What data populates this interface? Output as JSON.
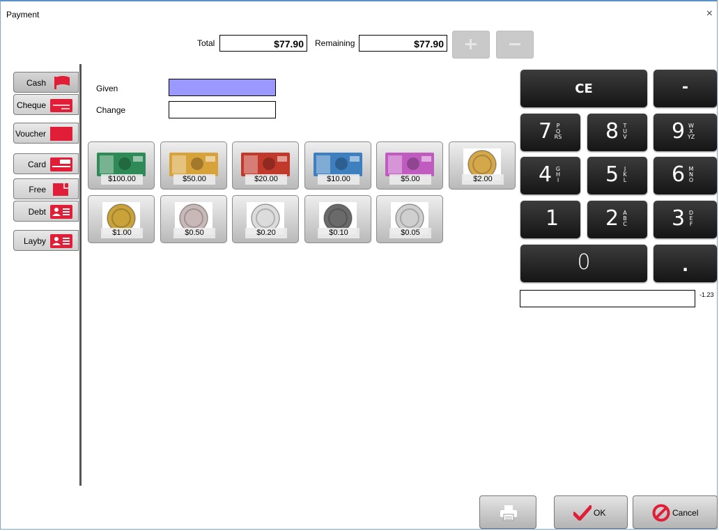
{
  "window": {
    "title": "Payment",
    "close_glyph": "×"
  },
  "header": {
    "total_label": "Total",
    "total_value": "$77.90",
    "remaining_label": "Remaining",
    "remaining_value": "$77.90",
    "plus_icon": "plus-icon",
    "minus_icon": "minus-icon"
  },
  "tabs": [
    {
      "label": "Cash",
      "icon": "flag-icon",
      "active": true
    },
    {
      "label": "Cheque",
      "icon": "cheque-icon"
    },
    {
      "label": "Voucher",
      "icon": "voucher-icon"
    },
    {
      "label": "Card",
      "icon": "card-icon"
    },
    {
      "label": "Free",
      "icon": "free-icon"
    },
    {
      "label": "Debt",
      "icon": "contact-card-icon"
    },
    {
      "label": "Layby",
      "icon": "contact-card-icon"
    }
  ],
  "given": {
    "label": "Given",
    "value": "",
    "color": "#9999ff"
  },
  "change": {
    "label": "Change",
    "value": ""
  },
  "denominations": [
    {
      "amount": "$100.00",
      "kind": "note",
      "color": "#2e8b57"
    },
    {
      "amount": "$50.00",
      "kind": "note",
      "color": "#d8a23a"
    },
    {
      "amount": "$20.00",
      "kind": "note",
      "color": "#c0392b"
    },
    {
      "amount": "$10.00",
      "kind": "note",
      "color": "#3d7fbf"
    },
    {
      "amount": "$5.00",
      "kind": "note",
      "color": "#c05cc0"
    },
    {
      "amount": "$2.00",
      "kind": "coin",
      "color": "#d4a84a"
    },
    {
      "amount": "$1.00",
      "kind": "coin",
      "color": "#c9a23a"
    },
    {
      "amount": "$0.50",
      "kind": "coin",
      "color": "#c8b8b8"
    },
    {
      "amount": "$0.20",
      "kind": "coin",
      "color": "#dcdcdc"
    },
    {
      "amount": "$0.10",
      "kind": "coin",
      "color": "#6a6a6a"
    },
    {
      "amount": "$0.05",
      "kind": "coin",
      "color": "#cfcfcf"
    }
  ],
  "keypad": {
    "ce": "CE",
    "minus": "-",
    "decimal": ".",
    "digits": [
      {
        "d": "7",
        "letters": [
          "P",
          "Q",
          "RS"
        ]
      },
      {
        "d": "8",
        "letters": [
          "T",
          "U",
          "V"
        ]
      },
      {
        "d": "9",
        "letters": [
          "W",
          "X",
          "YZ"
        ]
      },
      {
        "d": "4",
        "letters": [
          "G",
          "H",
          "I"
        ]
      },
      {
        "d": "5",
        "letters": [
          "J",
          "K",
          "L"
        ]
      },
      {
        "d": "6",
        "letters": [
          "M",
          "N",
          "O"
        ]
      },
      {
        "d": "1",
        "letters": []
      },
      {
        "d": "2",
        "letters": [
          "A",
          "B",
          "C"
        ]
      },
      {
        "d": "3",
        "letters": [
          "D",
          "E",
          "F"
        ]
      },
      {
        "d": "0",
        "letters": []
      }
    ],
    "display_value": "",
    "side_value": "-1.23"
  },
  "footer": {
    "print_icon": "printer-icon",
    "ok_label": "OK",
    "ok_icon": "checkmark-icon",
    "cancel_label": "Cancel",
    "cancel_icon": "cancel-icon",
    "accent": "#e01e37"
  }
}
